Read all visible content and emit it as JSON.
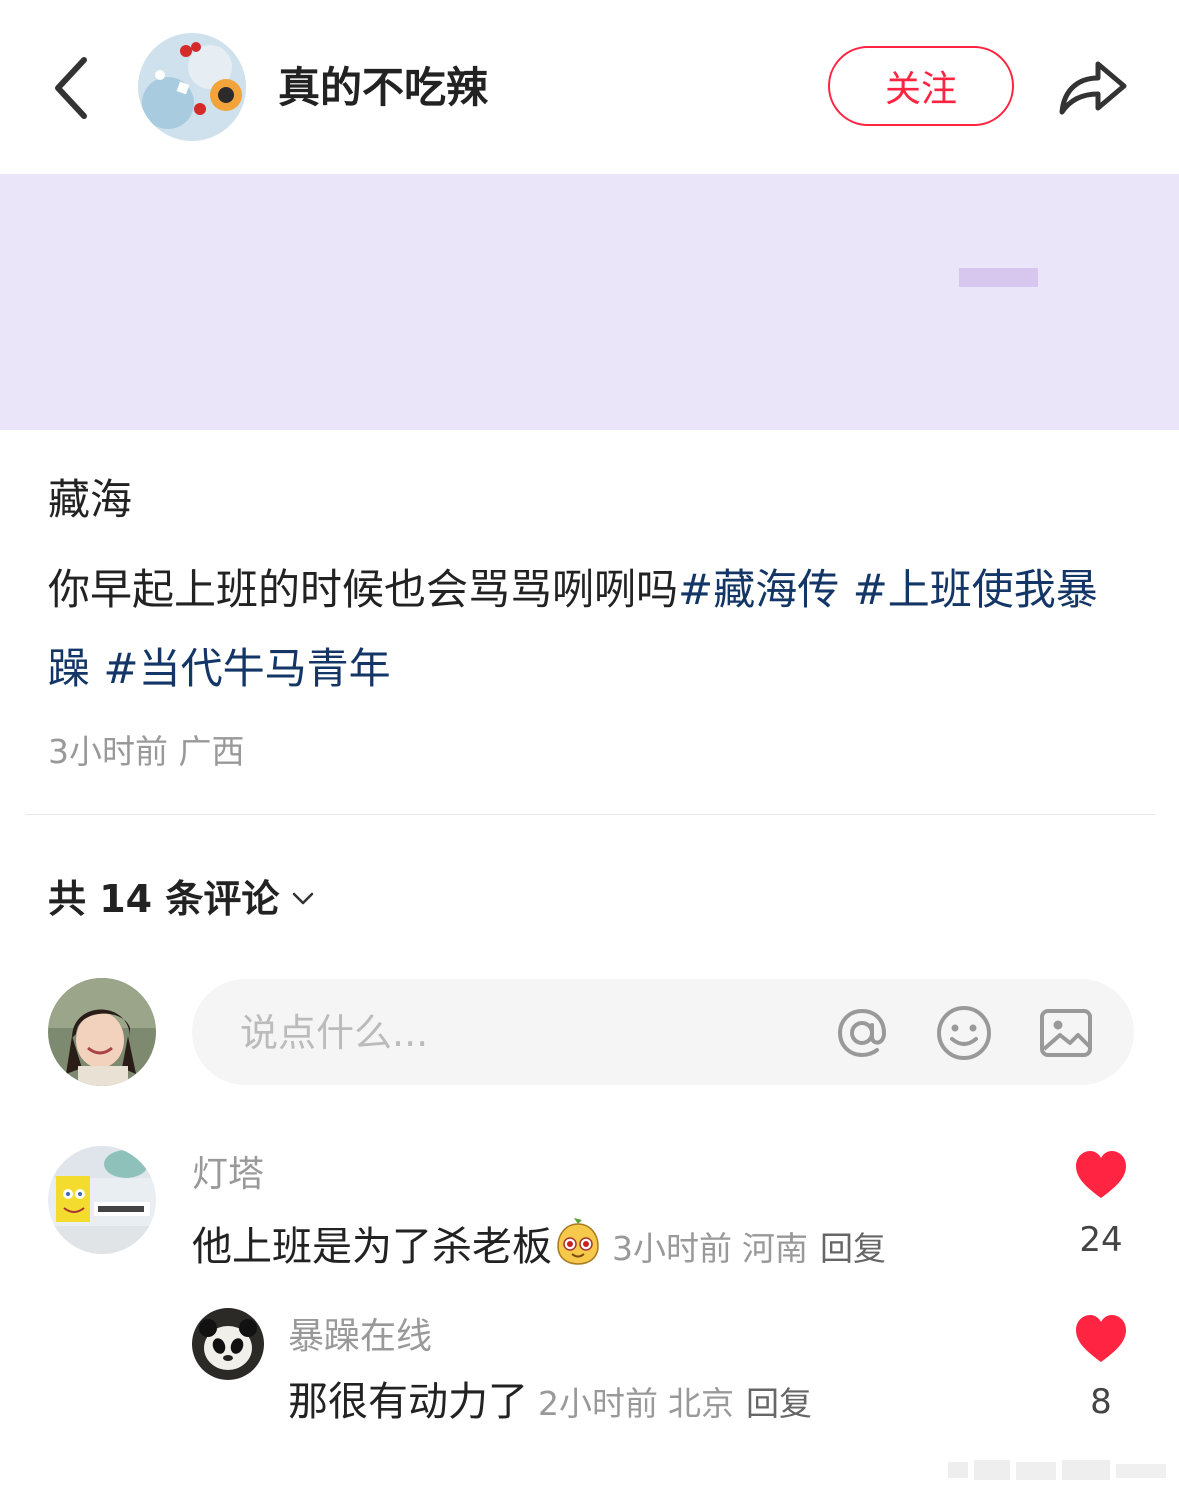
{
  "header": {
    "author_name": "真的不吃辣",
    "follow_label": "关注"
  },
  "post": {
    "title": "藏海",
    "body_text": "你早起上班的时候也会骂骂咧咧吗",
    "tags": [
      "#藏海传",
      "#上班使我暴躁",
      "#当代牛马青年"
    ],
    "time": "3小时前",
    "location": "广西"
  },
  "comments_header": {
    "count_label": "共 14 条评论"
  },
  "comment_input": {
    "placeholder": "说点什么..."
  },
  "comments": [
    {
      "user": "灯塔",
      "text": "他上班是为了杀老板",
      "time": "3小时前",
      "location": "河南",
      "reply_label": "回复",
      "likes": "24"
    },
    {
      "user": "暴躁在线",
      "text": "那很有动力了",
      "time": "2小时前",
      "location": "北京",
      "reply_label": "回复",
      "likes": "8"
    }
  ],
  "colors": {
    "accent": "#ff2442",
    "tag": "#133667",
    "image_bg": "#ebe5f9"
  },
  "icons": [
    "back-arrow-icon",
    "share-icon",
    "chevron-down-icon",
    "at-icon",
    "emoji-icon",
    "image-icon",
    "heart-icon",
    "emoji-sticker-icon"
  ]
}
